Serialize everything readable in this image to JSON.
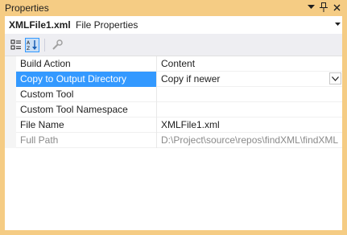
{
  "titlebar": {
    "title": "Properties",
    "buttons": [
      {
        "name": "dropdown-arrow",
        "glyph": "▾"
      },
      {
        "name": "pin",
        "glyph": "📌"
      },
      {
        "name": "close",
        "glyph": "✕"
      }
    ]
  },
  "selector": {
    "object_name": "XMLFile1.xml",
    "object_type": "File Properties"
  },
  "toolbar": {
    "buttons": [
      {
        "name": "categorized",
        "active": false
      },
      {
        "name": "alphabetical",
        "active": true
      },
      {
        "name": "property-pages",
        "active": false
      }
    ]
  },
  "properties": [
    {
      "name": "Build Action",
      "value": "Content",
      "selected": false,
      "disabled": false
    },
    {
      "name": "Copy to Output Directory",
      "value": "Copy if newer",
      "selected": true,
      "disabled": false
    },
    {
      "name": "Custom Tool",
      "value": "",
      "selected": false,
      "disabled": false
    },
    {
      "name": "Custom Tool Namespace",
      "value": "",
      "selected": false,
      "disabled": false
    },
    {
      "name": "File Name",
      "value": "XMLFile1.xml",
      "selected": false,
      "disabled": false
    },
    {
      "name": "Full Path",
      "value": "D:\\Project\\source\\repos\\findXML\\findXML",
      "selected": false,
      "disabled": true
    }
  ],
  "colors": {
    "accent_border": "#f5cc84",
    "selection": "#3399ff",
    "toolbar_bg": "#eeeef2"
  }
}
